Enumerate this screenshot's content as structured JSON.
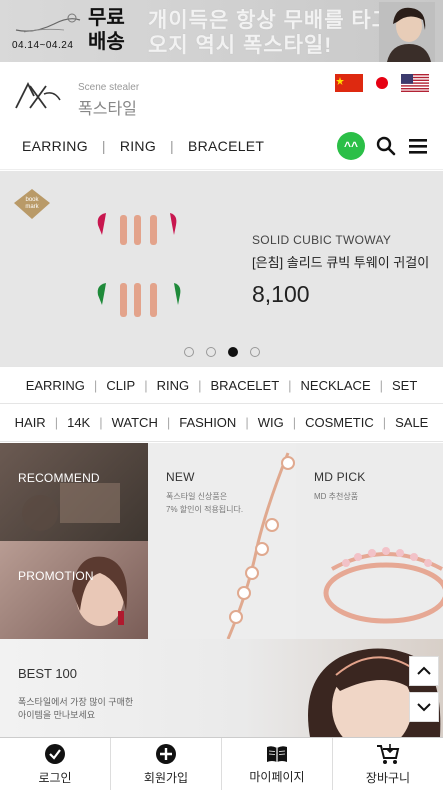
{
  "promo": {
    "date": "04.14~04.24",
    "free_line1": "무료",
    "free_line2": "배송",
    "copy_line1": "개이득은 항상 무배를 타고",
    "copy_line2": "오지 역시 폭스타일!"
  },
  "header": {
    "brand_sub": "Scene stealer",
    "brand_name": "폭스타일",
    "flags": [
      "china-flag-icon",
      "japan-flag-icon",
      "usa-flag-icon"
    ]
  },
  "nav": {
    "items": [
      "EARRING",
      "RING",
      "BRACELET"
    ],
    "separator": "|",
    "kakao_label": "^^",
    "tools": [
      "kakaotalk-icon",
      "search-icon",
      "menu-icon"
    ]
  },
  "hero": {
    "product_name": "SOLID CUBIC TWOWAY",
    "product_kname": "[은침] 솔리드 큐빅 투웨이 귀걸이",
    "price": "8,100",
    "slide_count": 4,
    "active_slide": 3
  },
  "categories_row1": [
    "EARRING",
    "CLIP",
    "RING",
    "BRACELET",
    "NECKLACE",
    "SET"
  ],
  "categories_row2": [
    "HAIR",
    "14K",
    "WATCH",
    "FASHION",
    "WIG",
    "COSMETIC",
    "SALE"
  ],
  "tiles": {
    "recommend": "RECOMMEND",
    "promotion": "PROMOTION",
    "new_title": "NEW",
    "new_sub1": "폭스타일 신상품은",
    "new_sub2": "7% 할인이 적용됩니다.",
    "md_title": "MD PICK",
    "md_sub": "MD 추천상품"
  },
  "best": {
    "title": "BEST 100",
    "sub1": "폭스타일에서 가장 많이 구매한",
    "sub2": "아이템을 만나보세요"
  },
  "bottom_bar": [
    {
      "label": "로그인",
      "icon": "check-circle-icon"
    },
    {
      "label": "회원가입",
      "icon": "plus-circle-icon"
    },
    {
      "label": "마이페이지",
      "icon": "book-icon"
    },
    {
      "label": "장바구니",
      "icon": "cart-icon"
    }
  ],
  "colors": {
    "kakao_green": "#2bbf47",
    "bookmark_gold": "#b99a68"
  }
}
